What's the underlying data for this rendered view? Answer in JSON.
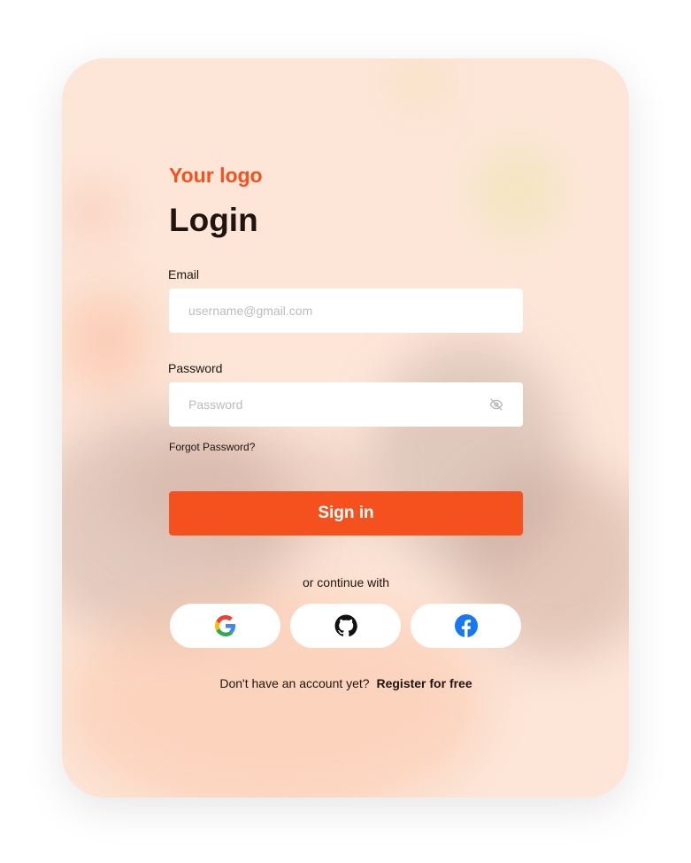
{
  "brand": {
    "logo_text": "Your logo",
    "accent_color": "#f4511e"
  },
  "login": {
    "title": "Login",
    "email_label": "Email",
    "email_placeholder": "username@gmail.com",
    "email_value": "",
    "password_label": "Password",
    "password_placeholder": "Password",
    "password_value": "",
    "password_toggle_icon": "eye-off-icon",
    "forgot_password": "Forgot Password?",
    "signin_label": "Sign in",
    "continue_with": "or continue with",
    "social_providers": [
      {
        "name": "google-icon"
      },
      {
        "name": "github-icon"
      },
      {
        "name": "facebook-icon"
      }
    ],
    "register_prompt": "Don't have an account yet?",
    "register_link": "Register for free"
  }
}
